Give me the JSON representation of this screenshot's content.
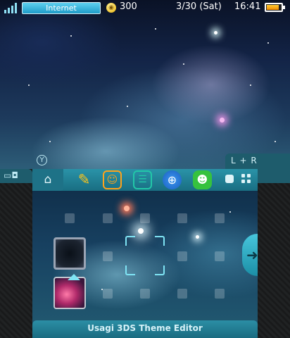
{
  "status_bar": {
    "internet_label": "Internet",
    "coin_count": "300",
    "date": "3/30 (Sat)",
    "time": "16:41",
    "battery_level": 0.85
  },
  "shoulder": {
    "left_label": "Y",
    "right_label": "L + R"
  },
  "toolbar": {
    "apps": [
      {
        "icon": "settings-icon",
        "color": "#1e7287"
      },
      {
        "icon": "pencil-icon",
        "color": "#ffc51a"
      },
      {
        "icon": "smiley-icon",
        "color": "#ffa21a"
      },
      {
        "icon": "chat-icon",
        "color": "#22c7a8"
      },
      {
        "icon": "globe-icon",
        "color": "#2b7fe0"
      },
      {
        "icon": "friends-icon",
        "color": "#36c23e"
      }
    ]
  },
  "theme": {
    "name": "Usagi 3DS Theme Editor"
  },
  "colors": {
    "accent": "#1e7287",
    "frame": "#1b1c1d",
    "highlight": "#7fe4f4"
  }
}
